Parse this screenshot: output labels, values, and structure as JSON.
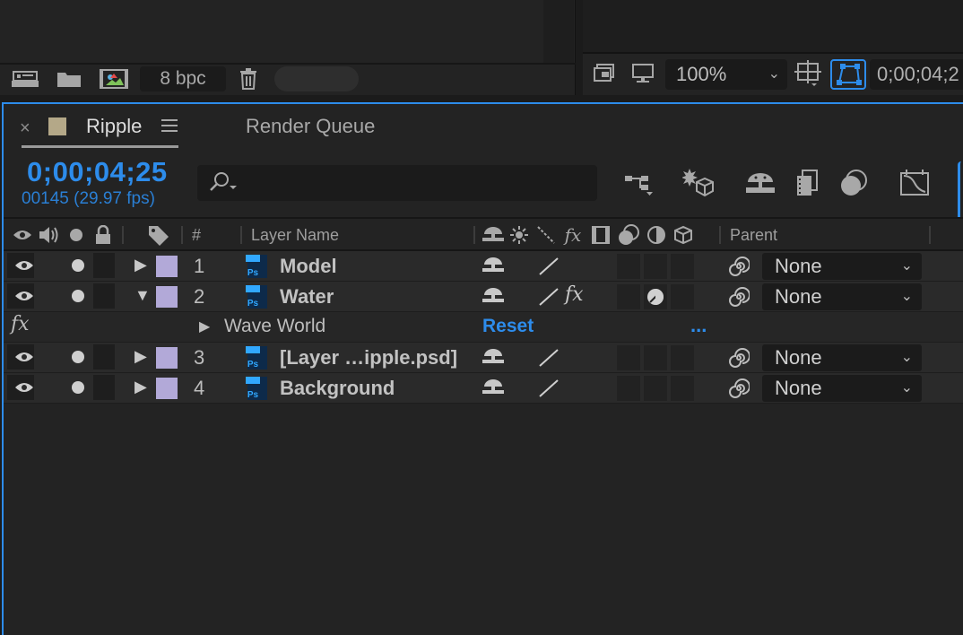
{
  "project_panel": {
    "bit_depth": "8 bpc",
    "icons": [
      "interpret-footage-icon",
      "new-folder-icon",
      "new-composition-icon",
      "trash-icon"
    ]
  },
  "viewer": {
    "zoom": "100%",
    "current_time": "0;00;04;2",
    "icons": [
      "snapshot-icon",
      "display-icon",
      "region-of-interest-icon",
      "toggle-transparency-grid-icon"
    ]
  },
  "timeline": {
    "tabs": [
      {
        "label": "Ripple",
        "close": "×"
      },
      {
        "label": "Render Queue"
      }
    ],
    "timecode": "0;00;04;25",
    "frames": "00145 (29.97 fps)",
    "search": {
      "value": "",
      "placeholder": ""
    },
    "columns": {
      "number": "#",
      "layer_name": "Layer Name",
      "parent": "Parent"
    },
    "layers": [
      {
        "num": "1",
        "name": "Model",
        "expanded": false,
        "fx": false,
        "parent": "None"
      },
      {
        "num": "2",
        "name": "Water",
        "expanded": true,
        "fx": true,
        "parent": "None"
      },
      {
        "num": "3",
        "name": "[Layer …ipple.psd]",
        "expanded": false,
        "fx": false,
        "parent": "None"
      },
      {
        "num": "4",
        "name": "Background",
        "expanded": false,
        "fx": false,
        "parent": "None"
      }
    ],
    "effect_row": {
      "fx_label": "fx",
      "name": "Wave World",
      "reset": "Reset",
      "more": "..."
    },
    "colors": {
      "accent": "#2d8ceb",
      "label_purple": "#b2a9d8",
      "comp_swatch": "#b4a888"
    }
  }
}
